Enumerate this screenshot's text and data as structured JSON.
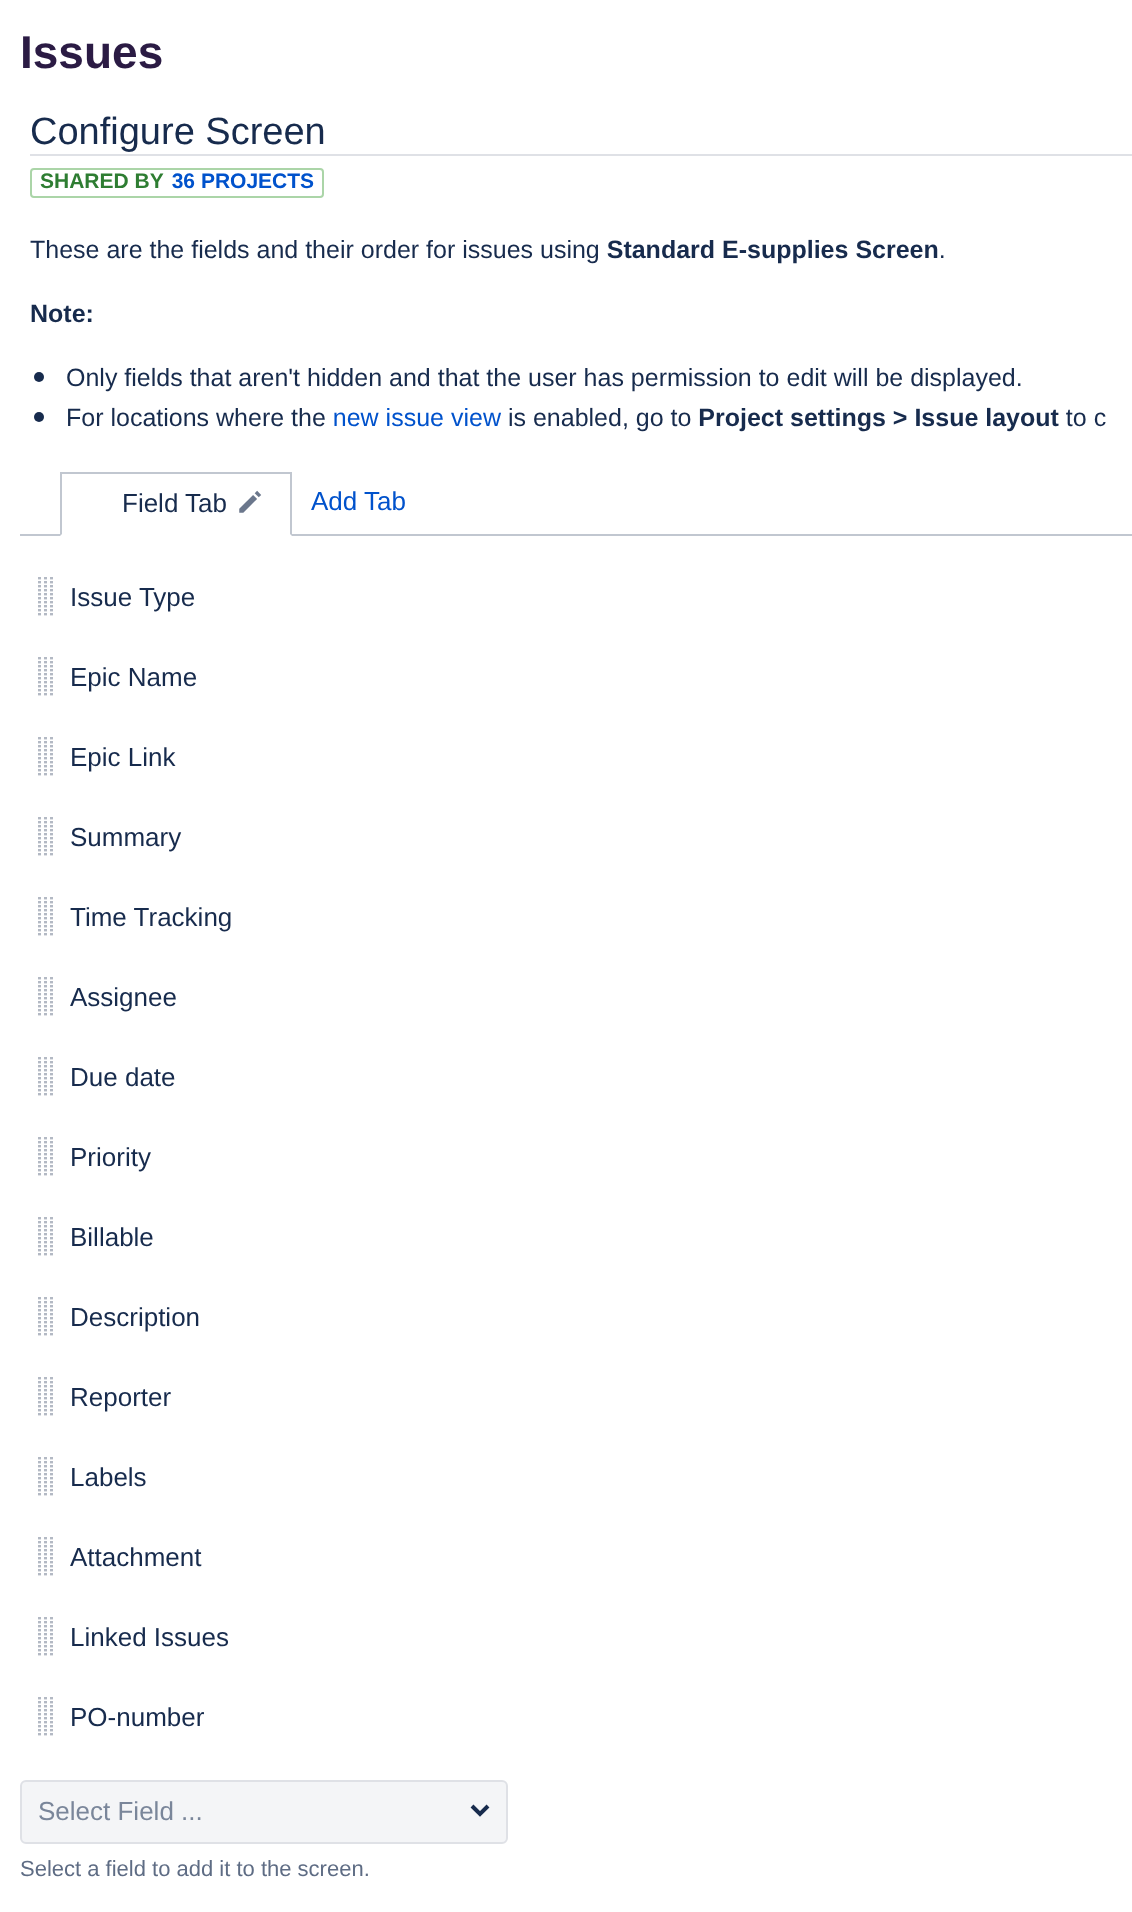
{
  "page_title": "Issues",
  "screen": {
    "title": "Configure Screen",
    "shared_label": "SHARED BY",
    "shared_link": "36 PROJECTS",
    "description": "These are the fields and their order for issues using **Standard E-supplies Screen**.",
    "note_heading": "Note:",
    "notes": [
      {
        "text": "Only fields that aren't hidden and that the user has permission to edit will be displayed."
      },
      {
        "text": "For locations where the ",
        "link": "new issue view",
        "after": " is enabled, go to **Project settings > Issue layout** to c"
      }
    ]
  },
  "tabs": [
    {
      "label": "Field Tab",
      "selected": true
    },
    {
      "label": "Add Tab",
      "selected": false
    }
  ],
  "fields": [
    {
      "name": "Issue Type"
    },
    {
      "name": "Epic Name"
    },
    {
      "name": "Epic Link"
    },
    {
      "name": "Summary"
    },
    {
      "name": "Time Tracking"
    },
    {
      "name": "Assignee"
    },
    {
      "name": "Due date"
    },
    {
      "name": "Priority"
    },
    {
      "name": "Billable"
    },
    {
      "name": "Description"
    },
    {
      "name": "Reporter"
    },
    {
      "name": "Labels"
    },
    {
      "name": "Attachment"
    },
    {
      "name": "Linked Issues"
    },
    {
      "name": "PO-number"
    }
  ],
  "add_field": {
    "placeholder": "Select Field ...",
    "help": "Select a field to add it to the screen."
  }
}
